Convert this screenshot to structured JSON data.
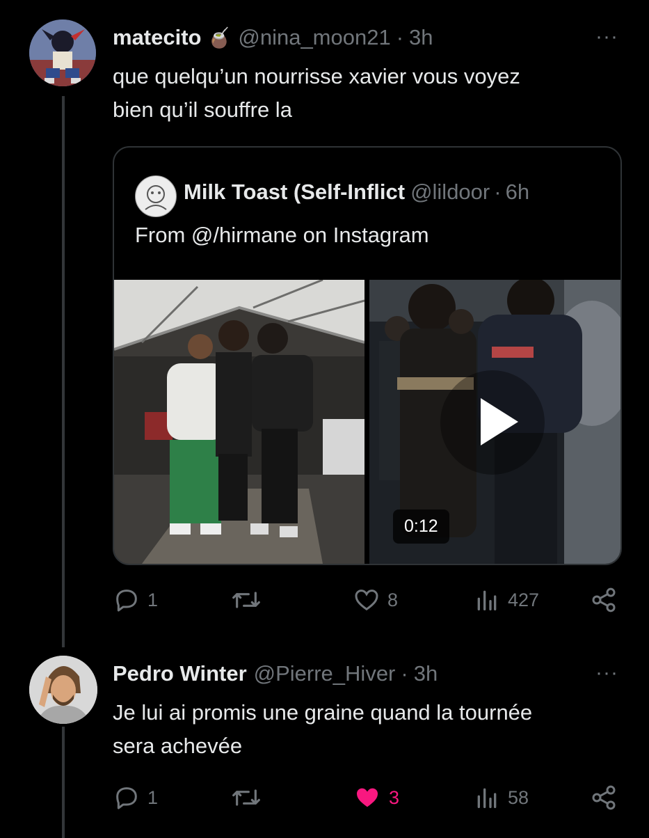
{
  "tweet1": {
    "name": "matecito",
    "emoji": "🧉",
    "handle": "@nina_moon21",
    "dot": "·",
    "time": "3h",
    "more": "···",
    "text_line1": "que quelqu’un nourrisse xavier vous voyez",
    "text_line2": "bien qu’il souffre la",
    "quote": {
      "name": "Milk Toast (Self-Inflict",
      "handle": "@lildoor",
      "dot": "·",
      "time": "6h",
      "text": "From @/hirmane on Instagram",
      "video_duration": "0:12"
    },
    "stats": {
      "replies": "1",
      "retweets": "",
      "likes": "8",
      "views": "427"
    }
  },
  "tweet2": {
    "name": "Pedro Winter",
    "handle": "@Pierre_Hiver",
    "dot": "·",
    "time": "3h",
    "more": "···",
    "text_line1": "Je lui ai promis une graine quand la tournée",
    "text_line2": "sera achevée",
    "stats": {
      "replies": "1",
      "retweets": "",
      "likes": "3",
      "views": "58"
    }
  },
  "colors": {
    "background": "#000000",
    "text": "#e7e9ea",
    "muted": "#71767b",
    "like": "#f91880",
    "border": "#2f3336"
  }
}
